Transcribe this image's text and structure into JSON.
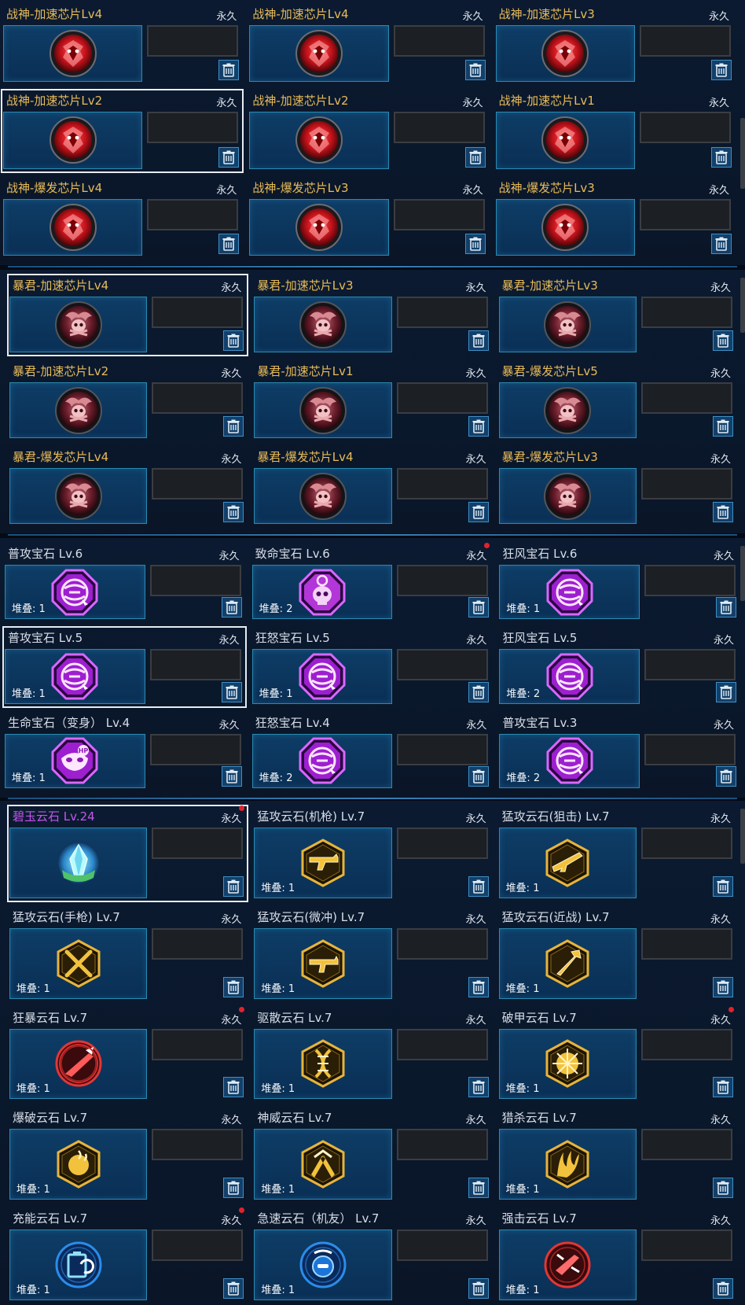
{
  "colors": {
    "gold_title": "#e9bb58",
    "purple_title": "#c455ef",
    "slot_blue": "#0e3d66",
    "red_dot": "#e0232b"
  },
  "stack_label": "堆叠",
  "sections": [
    {
      "items": [
        {
          "title": "战神-加速芯片Lv4",
          "duration": "永久",
          "title_style": "gold",
          "icon": "warlord-red-chip-icon"
        },
        {
          "title": "战神-加速芯片Lv4",
          "duration": "永久",
          "title_style": "gold",
          "icon": "warlord-red-chip-icon"
        },
        {
          "title": "战神-加速芯片Lv3",
          "duration": "永久",
          "title_style": "gold",
          "icon": "warlord-red-chip-icon"
        },
        {
          "title": "战神-加速芯片Lv2",
          "duration": "永久",
          "title_style": "gold",
          "icon": "warlord-red-chip-icon",
          "selected": true
        },
        {
          "title": "战神-加速芯片Lv2",
          "duration": "永久",
          "title_style": "gold",
          "icon": "warlord-red-chip-icon"
        },
        {
          "title": "战神-加速芯片Lv1",
          "duration": "永久",
          "title_style": "gold",
          "icon": "warlord-red-chip-icon"
        },
        {
          "title": "战神-爆发芯片Lv4",
          "duration": "永久",
          "title_style": "gold",
          "icon": "warlord-red-chip-icon"
        },
        {
          "title": "战神-爆发芯片Lv3",
          "duration": "永久",
          "title_style": "gold",
          "icon": "warlord-red-chip-icon"
        },
        {
          "title": "战神-爆发芯片Lv3",
          "duration": "永久",
          "title_style": "gold",
          "icon": "warlord-red-chip-icon"
        }
      ]
    },
    {
      "items": [
        {
          "title": "暴君-加速芯片Lv4",
          "duration": "永久",
          "title_style": "gold",
          "icon": "tyrant-skull-chip-icon",
          "selected": true
        },
        {
          "title": "暴君-加速芯片Lv3",
          "duration": "永久",
          "title_style": "gold",
          "icon": "tyrant-skull-chip-icon"
        },
        {
          "title": "暴君-加速芯片Lv3",
          "duration": "永久",
          "title_style": "gold",
          "icon": "tyrant-skull-chip-icon"
        },
        {
          "title": "暴君-加速芯片Lv2",
          "duration": "永久",
          "title_style": "gold",
          "icon": "tyrant-skull-chip-icon"
        },
        {
          "title": "暴君-加速芯片Lv1",
          "duration": "永久",
          "title_style": "gold",
          "icon": "tyrant-skull-chip-icon"
        },
        {
          "title": "暴君-爆发芯片Lv5",
          "duration": "永久",
          "title_style": "gold",
          "icon": "tyrant-skull-chip-icon"
        },
        {
          "title": "暴君-爆发芯片Lv4",
          "duration": "永久",
          "title_style": "gold",
          "icon": "tyrant-skull-chip-icon"
        },
        {
          "title": "暴君-爆发芯片Lv4",
          "duration": "永久",
          "title_style": "gold",
          "icon": "tyrant-skull-chip-icon"
        },
        {
          "title": "暴君-爆发芯片Lv3",
          "duration": "永久",
          "title_style": "gold",
          "icon": "tyrant-skull-chip-icon"
        }
      ]
    },
    {
      "items": [
        {
          "title": "普攻宝石 Lv.6",
          "duration": "永久",
          "icon": "normal-attack-gem-icon",
          "stack": "1"
        },
        {
          "title": "致命宝石 Lv.6",
          "duration": "永久",
          "icon": "lethal-skull-gem-icon",
          "stack": "2",
          "new": true
        },
        {
          "title": "狂风宝石 Lv.6",
          "duration": "永久",
          "icon": "normal-attack-gem-icon",
          "stack": "1"
        },
        {
          "title": "普攻宝石 Lv.5",
          "duration": "永久",
          "icon": "normal-attack-gem-icon",
          "stack": "1",
          "selected": true
        },
        {
          "title": "狂怒宝石 Lv.5",
          "duration": "永久",
          "icon": "normal-attack-gem-icon",
          "stack": "1"
        },
        {
          "title": "狂风宝石 Lv.5",
          "duration": "永久",
          "icon": "normal-attack-gem-icon",
          "stack": "2"
        },
        {
          "title": "生命宝石（变身） Lv.4",
          "duration": "永久",
          "icon": "hp-mask-gem-icon",
          "stack": "1"
        },
        {
          "title": "狂怒宝石 Lv.4",
          "duration": "永久",
          "icon": "normal-attack-gem-icon",
          "stack": "2"
        },
        {
          "title": "普攻宝石 Lv.3",
          "duration": "永久",
          "icon": "normal-attack-gem-icon",
          "stack": "2"
        }
      ]
    },
    {
      "items": [
        {
          "title": "碧玉云石 Lv.24",
          "duration": "永久",
          "title_style": "purple",
          "icon": "jade-crystal-icon",
          "selected": true,
          "new": true
        },
        {
          "title": "猛攻云石(机枪) Lv.7",
          "duration": "永久",
          "icon": "machinegun-stone-icon",
          "stack": "1"
        },
        {
          "title": "猛攻云石(狙击) Lv.7",
          "duration": "永久",
          "icon": "sniper-stone-icon",
          "stack": "1"
        },
        {
          "title": "猛攻云石(手枪) Lv.7",
          "duration": "永久",
          "icon": "pistol-stone-icon",
          "stack": "1"
        },
        {
          "title": "猛攻云石(微冲) Lv.7",
          "duration": "永久",
          "icon": "smg-stone-icon",
          "stack": "1"
        },
        {
          "title": "猛攻云石(近战) Lv.7",
          "duration": "永久",
          "icon": "melee-stone-icon",
          "stack": "1"
        },
        {
          "title": "狂暴云石 Lv.7",
          "duration": "永久",
          "icon": "berserk-stone-icon",
          "stack": "1",
          "new": true
        },
        {
          "title": "驱散云石 Lv.7",
          "duration": "永久",
          "icon": "dispel-dna-stone-icon",
          "stack": "1"
        },
        {
          "title": "破甲云石 Lv.7",
          "duration": "永久",
          "icon": "armor-break-stone-icon",
          "stack": "1",
          "new": true
        },
        {
          "title": "爆破云石 Lv.7",
          "duration": "永久",
          "icon": "blast-stone-icon",
          "stack": "1"
        },
        {
          "title": "神威云石 Lv.7",
          "duration": "永久",
          "icon": "divine-sword-stone-icon",
          "stack": "1"
        },
        {
          "title": "猎杀云石 Lv.7",
          "duration": "永久",
          "icon": "hunt-claw-stone-icon",
          "stack": "1"
        },
        {
          "title": "充能云石 Lv.7",
          "duration": "永久",
          "icon": "charge-battery-stone-icon",
          "stack": "1",
          "new": true
        },
        {
          "title": "急速云石（机友） Lv.7",
          "duration": "永久",
          "icon": "haste-robot-stone-icon",
          "stack": "1"
        },
        {
          "title": "强击云石 Lv.7",
          "duration": "永久",
          "icon": "strike-gun-stone-icon",
          "stack": "1"
        }
      ]
    }
  ]
}
